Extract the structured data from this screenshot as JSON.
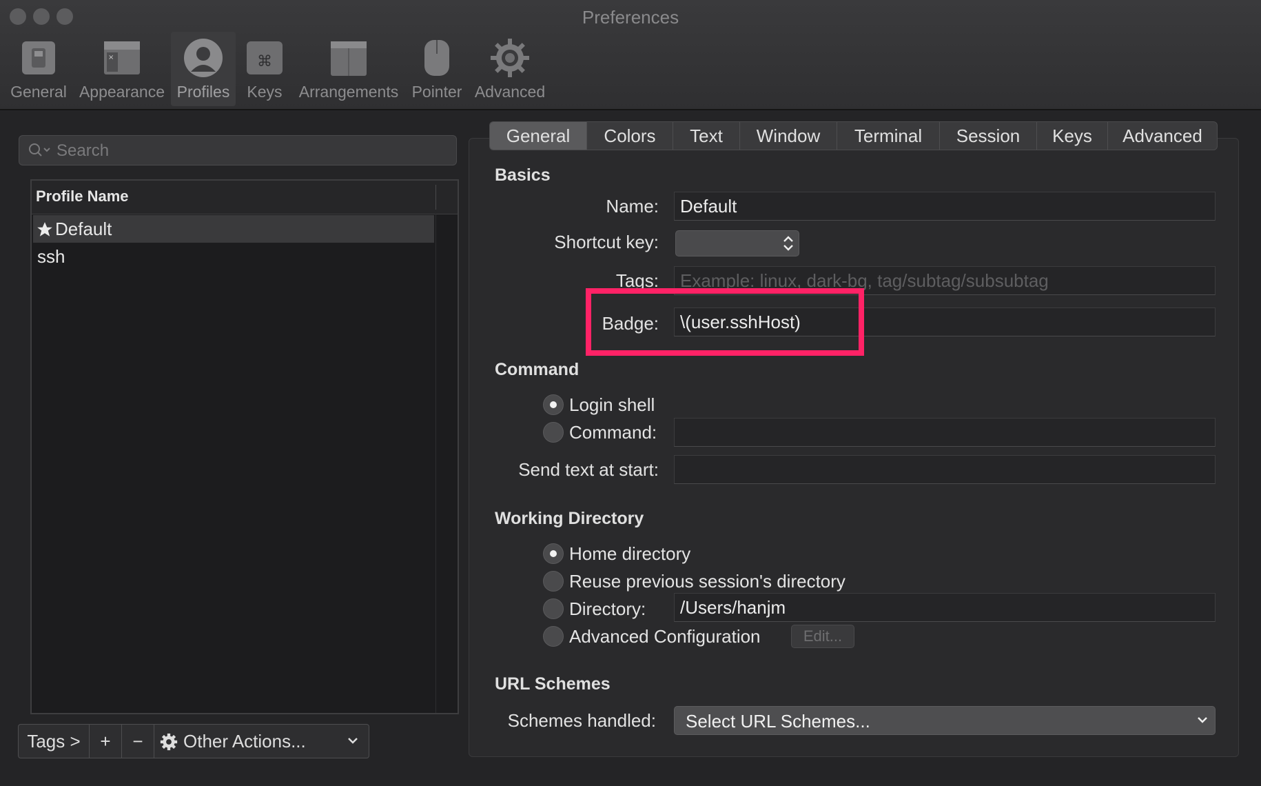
{
  "window": {
    "title": "Preferences"
  },
  "toolbar": {
    "items": [
      {
        "label": "General",
        "icon": "general-switch-icon"
      },
      {
        "label": "Appearance",
        "icon": "appearance-window-icon"
      },
      {
        "label": "Profiles",
        "icon": "profile-person-icon",
        "selected": true
      },
      {
        "label": "Keys",
        "icon": "command-key-icon"
      },
      {
        "label": "Arrangements",
        "icon": "arrangements-icon"
      },
      {
        "label": "Pointer",
        "icon": "mouse-icon"
      },
      {
        "label": "Advanced",
        "icon": "gear-icon"
      }
    ]
  },
  "sidebar": {
    "search_placeholder": "Search",
    "column_header": "Profile Name",
    "profiles": [
      {
        "name": "Default",
        "default": true,
        "selected": true
      },
      {
        "name": "ssh"
      }
    ],
    "bottom": {
      "tags": "Tags >",
      "add": "+",
      "remove": "−",
      "other_actions": "Other Actions..."
    }
  },
  "tabs": [
    {
      "label": "General",
      "selected": true
    },
    {
      "label": "Colors"
    },
    {
      "label": "Text"
    },
    {
      "label": "Window"
    },
    {
      "label": "Terminal"
    },
    {
      "label": "Session"
    },
    {
      "label": "Keys"
    },
    {
      "label": "Advanced"
    }
  ],
  "basics": {
    "title": "Basics",
    "name_label": "Name:",
    "name_value": "Default",
    "shortcut_label": "Shortcut key:",
    "tags_label": "Tags:",
    "tags_placeholder": "Example: linux, dark-bg, tag/subtag/subsubtag",
    "badge_label": "Badge:",
    "badge_value": "\\(user.sshHost)"
  },
  "command": {
    "title": "Command",
    "login_shell": "Login shell",
    "command_label": "Command:",
    "send_text_label": "Send text at start:",
    "selected": "Login shell"
  },
  "working_directory": {
    "title": "Working Directory",
    "home": "Home directory",
    "reuse": "Reuse previous session's directory",
    "directory_label": "Directory:",
    "directory_value": "/Users/hanjm",
    "advanced": "Advanced Configuration",
    "edit_button": "Edit...",
    "selected": "Home directory"
  },
  "url_schemes": {
    "title": "URL Schemes",
    "handled_label": "Schemes handled:",
    "select_value": "Select URL Schemes..."
  },
  "colors": {
    "highlight": "#ff2266",
    "background": "#242426"
  }
}
